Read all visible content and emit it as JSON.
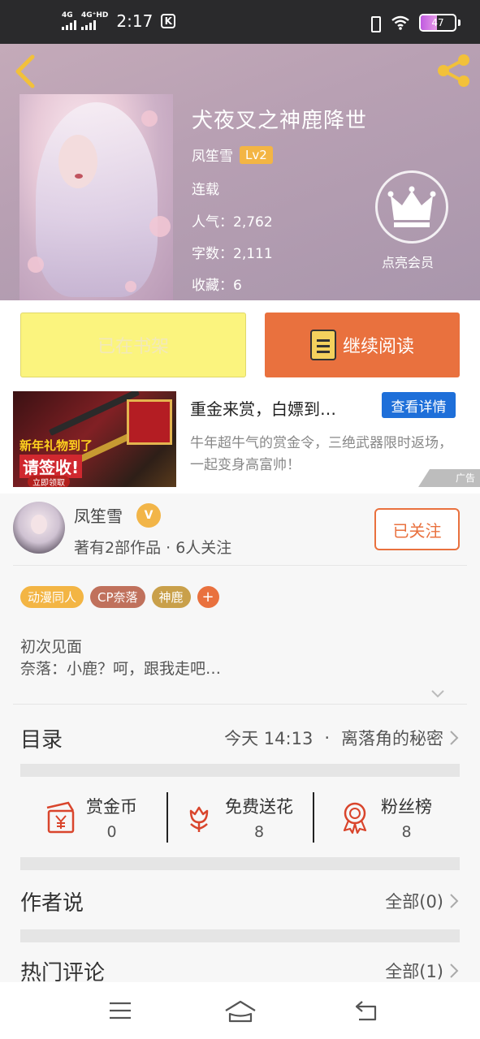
{
  "status_bar": {
    "net1": "4G",
    "net2": "4G⁺HD",
    "time": "2:17",
    "k_badge": "K",
    "battery": "47"
  },
  "header": {
    "title": "犬夜叉之神鹿降世",
    "author": "凤笙雪",
    "level": "Lv2",
    "status": "连载",
    "popularity": "人气：2,762",
    "words": "字数：2,111",
    "favorites": "收藏：6",
    "member_label": "点亮会员"
  },
  "actions": {
    "shelf": "已在书架",
    "read": "继续阅读"
  },
  "ad": {
    "title": "重金来赏，白嫖到…",
    "button": "查看详情",
    "desc": "牛年超牛气的赏金令，三绝武器限时返场，一起变身高富帅！",
    "tag": "广告",
    "img_line1": "新年礼物到了",
    "img_line2": "请签收!",
    "img_cta": "立即领取"
  },
  "author_card": {
    "name": "凤笙雪",
    "v_badge": "V",
    "sub": "著有2部作品 · 6人关注",
    "follow": "已关注"
  },
  "tags": [
    {
      "label": "动漫同人",
      "color": "#f3b544"
    },
    {
      "label": "CP奈落",
      "color": "#c0715c"
    },
    {
      "label": "神鹿",
      "color": "#c9a04a"
    }
  ],
  "tag_add": "+",
  "intro": {
    "line1": "初次见面",
    "line2": "奈落：小鹿？呵，跟我走吧…"
  },
  "toc": {
    "label": "目录",
    "time": "今天 14:13",
    "dot": "·",
    "chapter": "离落角的秘密"
  },
  "stats": [
    {
      "label": "赏金币",
      "value": "0",
      "icon": "envelope-yen-icon"
    },
    {
      "label": "免费送花",
      "value": "8",
      "icon": "flower-icon"
    },
    {
      "label": "粉丝榜",
      "value": "8",
      "icon": "medal-icon"
    }
  ],
  "author_says": {
    "label": "作者说",
    "right": "全部(0)"
  },
  "hot_comments": {
    "label": "热门评论",
    "right": "全部(1)"
  },
  "colors": {
    "accent": "#e9713e",
    "shelf_yellow": "#fbf47e",
    "ad_blue": "#1e6fd9",
    "badge_gold": "#f3b544"
  }
}
